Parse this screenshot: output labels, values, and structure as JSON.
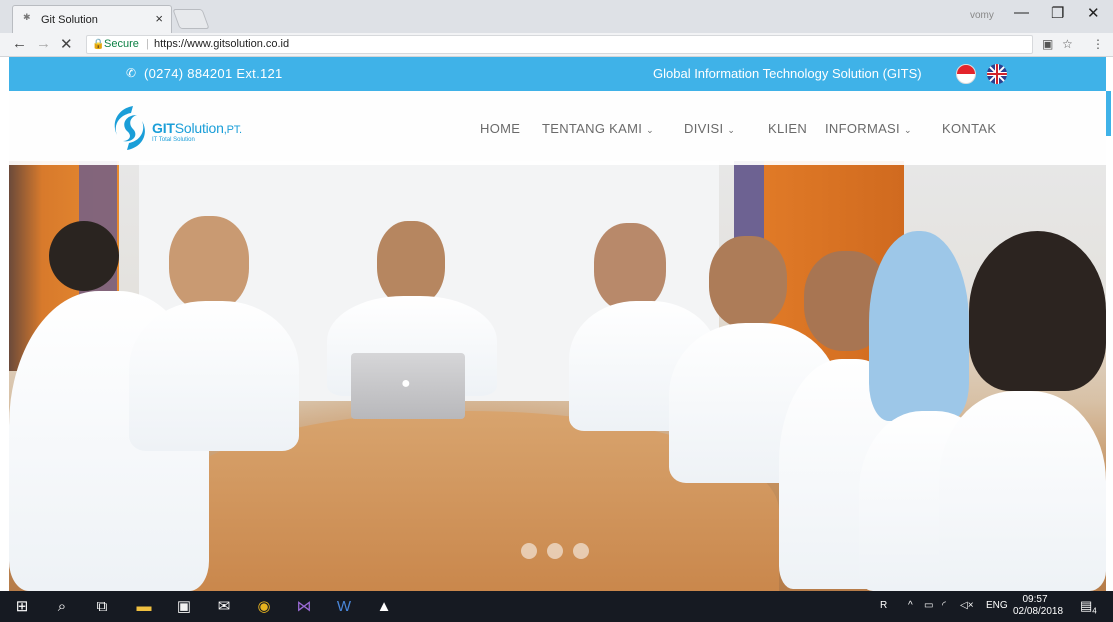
{
  "browser": {
    "tab_title": "Git Solution",
    "tab_close": "×",
    "profile": "vomy",
    "secure_label": "Secure",
    "url": "https://www.gitsolution.co.id",
    "win_min": "—",
    "win_restore": "❐",
    "win_close": "✕"
  },
  "topbar": {
    "phone": "(0274) 884201 Ext.121",
    "tagline": "Global Information Technology Solution (GITS)"
  },
  "logo": {
    "brand_bold": "GIT",
    "brand_rest": "Solution",
    "brand_suffix": ",PT.",
    "subtitle": "IT Total Solution"
  },
  "nav": {
    "home": "HOME",
    "about": "TENTANG KAMI",
    "division": "DIVISI",
    "clients": "KLIEN",
    "info": "INFORMASI",
    "contact": "KONTAK"
  },
  "taskbar": {
    "tray_user": "R",
    "tray_lang": "ENG",
    "time": "09:57",
    "date": "02/08/2018",
    "notification_count": "4"
  },
  "colors": {
    "accent": "#3fb2e8",
    "logo_blue": "#1a9ed8",
    "taskbar": "#161a22"
  }
}
